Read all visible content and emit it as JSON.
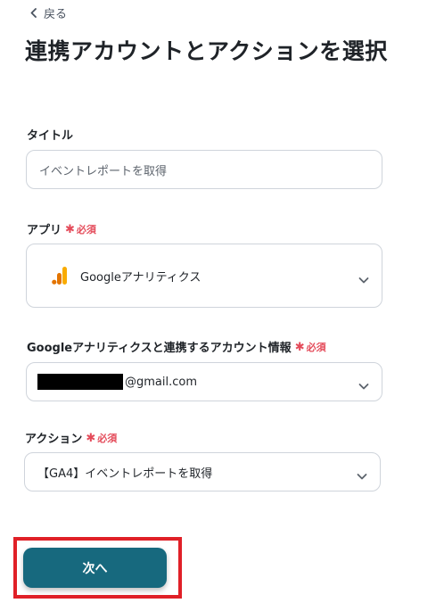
{
  "nav": {
    "back_label": "戻る"
  },
  "page": {
    "title": "連携アカウントとアクションを選択"
  },
  "form": {
    "title_field": {
      "label": "タイトル",
      "value": "イベントレポートを取得"
    },
    "app_field": {
      "label": "アプリ",
      "required_label": "必須",
      "value": "Googleアナリティクス",
      "icon": "google-analytics-icon"
    },
    "account_field": {
      "label": "Googleアナリティクスと連携するアカウント情報",
      "required_label": "必須",
      "email_suffix": "@gmail.com"
    },
    "action_field": {
      "label": "アクション",
      "required_label": "必須",
      "value": "【GA4】イベントレポートを取得"
    }
  },
  "footer": {
    "next_label": "次へ"
  },
  "colors": {
    "accent": "#17697e",
    "required": "#e44b5a",
    "highlight": "#e02027",
    "ga_orange": "#f9ab00",
    "ga_dark_orange": "#e37400"
  }
}
